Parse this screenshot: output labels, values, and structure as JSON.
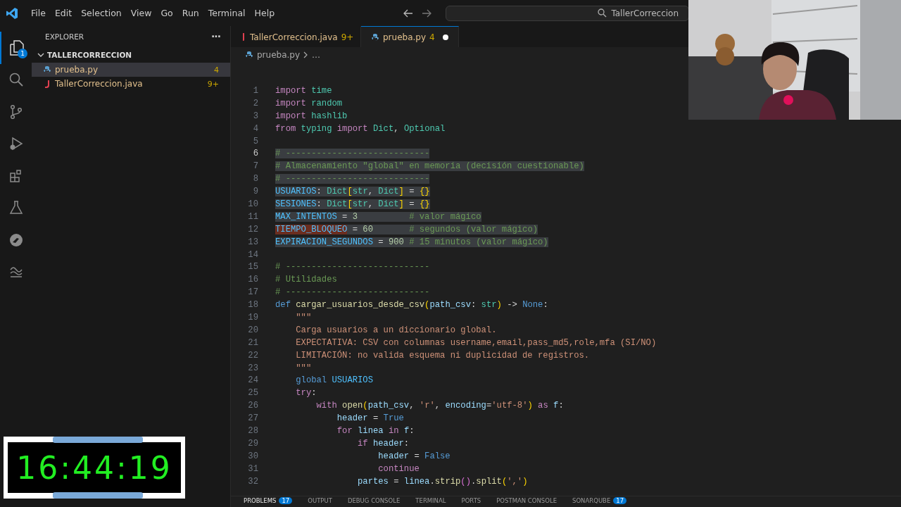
{
  "menu": [
    "File",
    "Edit",
    "Selection",
    "View",
    "Go",
    "Run",
    "Terminal",
    "Help"
  ],
  "command_center": {
    "title": "TallerCorreccion"
  },
  "activity_bar": {
    "explorer_badge": "1"
  },
  "explorer": {
    "title": "EXPLORER",
    "more": "···",
    "folder": {
      "name": "TALLERCORRECCION",
      "expanded": true
    },
    "files": [
      {
        "name": "prueba.py",
        "kind": "python",
        "badge": "4",
        "selected": true
      },
      {
        "name": "TallerCorreccion.java",
        "kind": "java",
        "badge": "9+",
        "selected": false
      }
    ]
  },
  "tabs": [
    {
      "label": "TallerCorreccion.java",
      "kind": "java",
      "badge": "9+",
      "selected": false,
      "modified": false
    },
    {
      "label": "prueba.py",
      "kind": "python",
      "badge": "4",
      "selected": true,
      "modified": true
    }
  ],
  "breadcrumb": {
    "file": "prueba.py",
    "rest": "…"
  },
  "code": [
    {
      "n": "1",
      "selected": false,
      "current": false,
      "tokens": [
        {
          "t": "import ",
          "kind": "kw"
        },
        {
          "t": "time",
          "kind": "mod"
        }
      ]
    },
    {
      "n": "2",
      "selected": false,
      "current": false,
      "tokens": [
        {
          "t": "import ",
          "kind": "kw"
        },
        {
          "t": "random",
          "kind": "mod"
        }
      ]
    },
    {
      "n": "3",
      "selected": false,
      "current": false,
      "tokens": [
        {
          "t": "import ",
          "kind": "kw"
        },
        {
          "t": "hashlib",
          "kind": "mod"
        }
      ]
    },
    {
      "n": "4",
      "selected": false,
      "current": false,
      "tokens": [
        {
          "t": "from ",
          "kind": "kw"
        },
        {
          "t": "typing ",
          "kind": "mod"
        },
        {
          "t": "import ",
          "kind": "kw"
        },
        {
          "t": "Dict",
          "kind": "mod"
        },
        {
          "t": ", ",
          "kind": "p"
        },
        {
          "t": "Optional",
          "kind": "mod"
        }
      ]
    },
    {
      "n": "5",
      "current": false
    },
    {
      "n": "6",
      "selected": true,
      "current": true,
      "tokens": [
        {
          "t": "# ----------------------------",
          "kind": "com"
        }
      ]
    },
    {
      "n": "7",
      "selected": true,
      "current": false,
      "tokens": [
        {
          "t": "# Almacenamiento \"global\" en memoria (decisión cuestionable)",
          "kind": "com"
        }
      ]
    },
    {
      "n": "8",
      "selected": true,
      "current": false,
      "tokens": [
        {
          "t": "# ----------------------------",
          "kind": "com"
        }
      ]
    },
    {
      "n": "9",
      "selected": true,
      "current": false,
      "tokens": [
        {
          "t": "USUARIOS",
          "kind": "const"
        },
        {
          "t": ": ",
          "kind": "p"
        },
        {
          "t": "Dict",
          "kind": "mod"
        },
        {
          "t": "[",
          "kind": "br"
        },
        {
          "t": "str",
          "kind": "mod"
        },
        {
          "t": ", ",
          "kind": "p"
        },
        {
          "t": "Dict",
          "kind": "mod"
        },
        {
          "t": "]",
          "kind": "br"
        },
        {
          "t": " = ",
          "kind": "p"
        },
        {
          "t": "{}",
          "kind": "br"
        }
      ]
    },
    {
      "n": "10",
      "selected": true,
      "current": false,
      "tokens": [
        {
          "t": "SESIONES",
          "kind": "const"
        },
        {
          "t": ": ",
          "kind": "p"
        },
        {
          "t": "Dict",
          "kind": "mod"
        },
        {
          "t": "[",
          "kind": "br"
        },
        {
          "t": "str",
          "kind": "mod"
        },
        {
          "t": ", ",
          "kind": "p"
        },
        {
          "t": "Dict",
          "kind": "mod"
        },
        {
          "t": "]",
          "kind": "br"
        },
        {
          "t": " = ",
          "kind": "p"
        },
        {
          "t": "{}",
          "kind": "br"
        }
      ]
    },
    {
      "n": "11",
      "selected": true,
      "current": false,
      "tokens": [
        {
          "t": "MAX_INTENTOS",
          "kind": "const"
        },
        {
          "t": " = ",
          "kind": "p"
        },
        {
          "t": "3          ",
          "kind": "num"
        },
        {
          "t": "# valor mágico",
          "kind": "com"
        }
      ]
    },
    {
      "n": "12",
      "selected": true,
      "current": false,
      "tokens": [
        {
          "t": "TIEMPO_BLOQUEO",
          "kind": "hl"
        },
        {
          "t": " = ",
          "kind": "p"
        },
        {
          "t": "60       ",
          "kind": "num"
        },
        {
          "t": "# segundos (valor mágico)",
          "kind": "com"
        }
      ]
    },
    {
      "n": "13",
      "selected": true,
      "current": false,
      "tokens": [
        {
          "t": "EXPIRACION_SEGUNDOS",
          "kind": "const"
        },
        {
          "t": " = ",
          "kind": "p"
        },
        {
          "t": "900 ",
          "kind": "num"
        },
        {
          "t": "# 15 minutos (valor mágico)",
          "kind": "com"
        }
      ]
    },
    {
      "n": "14",
      "current": false
    },
    {
      "n": "15",
      "selected": false,
      "current": false,
      "tokens": [
        {
          "t": "# ----------------------------",
          "kind": "com"
        }
      ]
    },
    {
      "n": "16",
      "selected": false,
      "current": false,
      "tokens": [
        {
          "t": "# Utilidades",
          "kind": "com"
        }
      ]
    },
    {
      "n": "17",
      "selected": false,
      "current": false,
      "tokens": [
        {
          "t": "# ----------------------------",
          "kind": "com"
        }
      ]
    },
    {
      "n": "18",
      "selected": false,
      "current": false,
      "tokens": [
        {
          "t": "def ",
          "kind": "decl"
        },
        {
          "t": "cargar_usuarios_desde_csv",
          "kind": "fn"
        },
        {
          "t": "(",
          "kind": "br"
        },
        {
          "t": "path_csv",
          "kind": "var"
        },
        {
          "t": ": ",
          "kind": "p"
        },
        {
          "t": "str",
          "kind": "mod"
        },
        {
          "t": ")",
          "kind": "br"
        },
        {
          "t": " -> ",
          "kind": "p"
        },
        {
          "t": "None",
          "kind": "decl"
        },
        {
          "t": ":",
          "kind": "p"
        }
      ]
    },
    {
      "n": "19",
      "selected": false,
      "current": false,
      "tokens": [
        {
          "t": "    \"\"\"",
          "kind": "str"
        }
      ]
    },
    {
      "n": "20",
      "selected": false,
      "current": false,
      "tokens": [
        {
          "t": "    Carga usuarios a un diccionario global.",
          "kind": "str"
        }
      ]
    },
    {
      "n": "21",
      "selected": false,
      "current": false,
      "tokens": [
        {
          "t": "    EXPECTATIVA: CSV con columnas username,email,pass_md5,role,mfa (SI/NO)",
          "kind": "str"
        }
      ]
    },
    {
      "n": "22",
      "selected": false,
      "current": false,
      "tokens": [
        {
          "t": "    LIMITACIÓN: no valida esquema ni duplicidad de registros.",
          "kind": "str"
        }
      ]
    },
    {
      "n": "23",
      "selected": false,
      "current": false,
      "tokens": [
        {
          "t": "    \"\"\"",
          "kind": "str"
        }
      ]
    },
    {
      "n": "24",
      "selected": false,
      "current": false,
      "tokens": [
        {
          "t": "    global ",
          "kind": "decl"
        },
        {
          "t": "USUARIOS",
          "kind": "const"
        }
      ]
    },
    {
      "n": "25",
      "selected": false,
      "current": false,
      "tokens": [
        {
          "t": "    try",
          "kind": "kw"
        },
        {
          "t": ":",
          "kind": "p"
        }
      ]
    },
    {
      "n": "26",
      "selected": false,
      "current": false,
      "tokens": [
        {
          "t": "        with ",
          "kind": "kw"
        },
        {
          "t": "open",
          "kind": "fn"
        },
        {
          "t": "(",
          "kind": "br"
        },
        {
          "t": "path_csv",
          "kind": "var"
        },
        {
          "t": ", ",
          "kind": "p"
        },
        {
          "t": "'r'",
          "kind": "str"
        },
        {
          "t": ", ",
          "kind": "p"
        },
        {
          "t": "encoding",
          "kind": "var"
        },
        {
          "t": "=",
          "kind": "p"
        },
        {
          "t": "'utf-8'",
          "kind": "str"
        },
        {
          "t": ")",
          "kind": "br"
        },
        {
          "t": " as ",
          "kind": "kw"
        },
        {
          "t": "f",
          "kind": "var"
        },
        {
          "t": ":",
          "kind": "p"
        }
      ]
    },
    {
      "n": "27",
      "selected": false,
      "current": false,
      "tokens": [
        {
          "t": "            header",
          "kind": "var"
        },
        {
          "t": " = ",
          "kind": "p"
        },
        {
          "t": "True",
          "kind": "decl"
        }
      ]
    },
    {
      "n": "28",
      "selected": false,
      "current": false,
      "tokens": [
        {
          "t": "            for ",
          "kind": "kw"
        },
        {
          "t": "linea ",
          "kind": "var"
        },
        {
          "t": "in ",
          "kind": "kw"
        },
        {
          "t": "f",
          "kind": "var"
        },
        {
          "t": ":",
          "kind": "p"
        }
      ]
    },
    {
      "n": "29",
      "selected": false,
      "current": false,
      "tokens": [
        {
          "t": "                if ",
          "kind": "kw"
        },
        {
          "t": "header",
          "kind": "var"
        },
        {
          "t": ":",
          "kind": "p"
        }
      ]
    },
    {
      "n": "30",
      "selected": false,
      "current": false,
      "tokens": [
        {
          "t": "                    header",
          "kind": "var"
        },
        {
          "t": " = ",
          "kind": "p"
        },
        {
          "t": "False",
          "kind": "decl"
        }
      ]
    },
    {
      "n": "31",
      "selected": false,
      "current": false,
      "tokens": [
        {
          "t": "                    continue",
          "kind": "kw"
        }
      ]
    },
    {
      "n": "32",
      "selected": false,
      "current": false,
      "tokens": [
        {
          "t": "                partes",
          "kind": "var"
        },
        {
          "t": " = ",
          "kind": "p"
        },
        {
          "t": "linea",
          "kind": "var"
        },
        {
          "t": ".",
          "kind": "p"
        },
        {
          "t": "strip",
          "kind": "fn"
        },
        {
          "t": "()",
          "kind": "br2"
        },
        {
          "t": ".",
          "kind": "p"
        },
        {
          "t": "split",
          "kind": "fn"
        },
        {
          "t": "(",
          "kind": "br"
        },
        {
          "t": "','",
          "kind": "str"
        },
        {
          "t": ")",
          "kind": "br"
        }
      ]
    }
  ],
  "panel_tabs": [
    {
      "label": "PROBLEMS",
      "badge": "17",
      "selected": true
    },
    {
      "label": "OUTPUT",
      "selected": false
    },
    {
      "label": "DEBUG CONSOLE",
      "selected": false
    },
    {
      "label": "TERMINAL",
      "selected": false
    },
    {
      "label": "PORTS",
      "selected": false
    },
    {
      "label": "POSTMAN CONSOLE",
      "selected": false
    },
    {
      "label": "SONARQUBE",
      "badge": "17",
      "selected": false
    }
  ],
  "timer": "16:44:19"
}
